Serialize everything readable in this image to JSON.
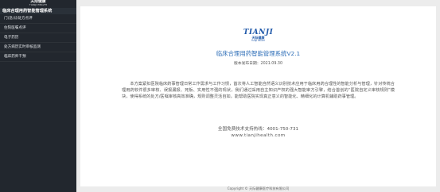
{
  "sidebar": {
    "brand_cn": "天际健康",
    "brand_en": "TIANJI HEALTH",
    "system_title": "临床合理用药智能管理系统",
    "items": [
      {
        "label": "门(急)诊处方点评"
      },
      {
        "label": "住院医嘱点评"
      },
      {
        "label": "电子药历"
      },
      {
        "label": "处方病历实时审核监测"
      },
      {
        "label": "临床药师干预"
      }
    ]
  },
  "main": {
    "logo_mark": "TIANJI",
    "logo_cn": "天际健康",
    "logo_en": "TIANJI HEALTH",
    "title": "临床合理用药智能管理系统V2.1",
    "release_date": "版本发布日期：2021.09.30",
    "description": "本方案紧扣医院临床药事管理日常工作需求与工作习惯，首次将人工智能自然语义识别技术应用于临床用药合理性的智能分析与管理，针对传统合理用药软件很多审核、误报漏报、死板、实用性不强的现状，我们通过采用自主知识产权的强大智能审方引擎，结合首创的“医院自定义审核规则”模块，使得系统的处方/医嘱审核高效准确，规则调整灵活自如，能帮助医院实现真正意义的智能化、精细化的计算机辅助药事管理。",
    "hotline": "全国免费技术支持热线：4001-750-731",
    "website": "www.tianjihealth.com"
  },
  "footer": {
    "copyright": "Copyright © 天际健康医疗科技有限公司"
  }
}
